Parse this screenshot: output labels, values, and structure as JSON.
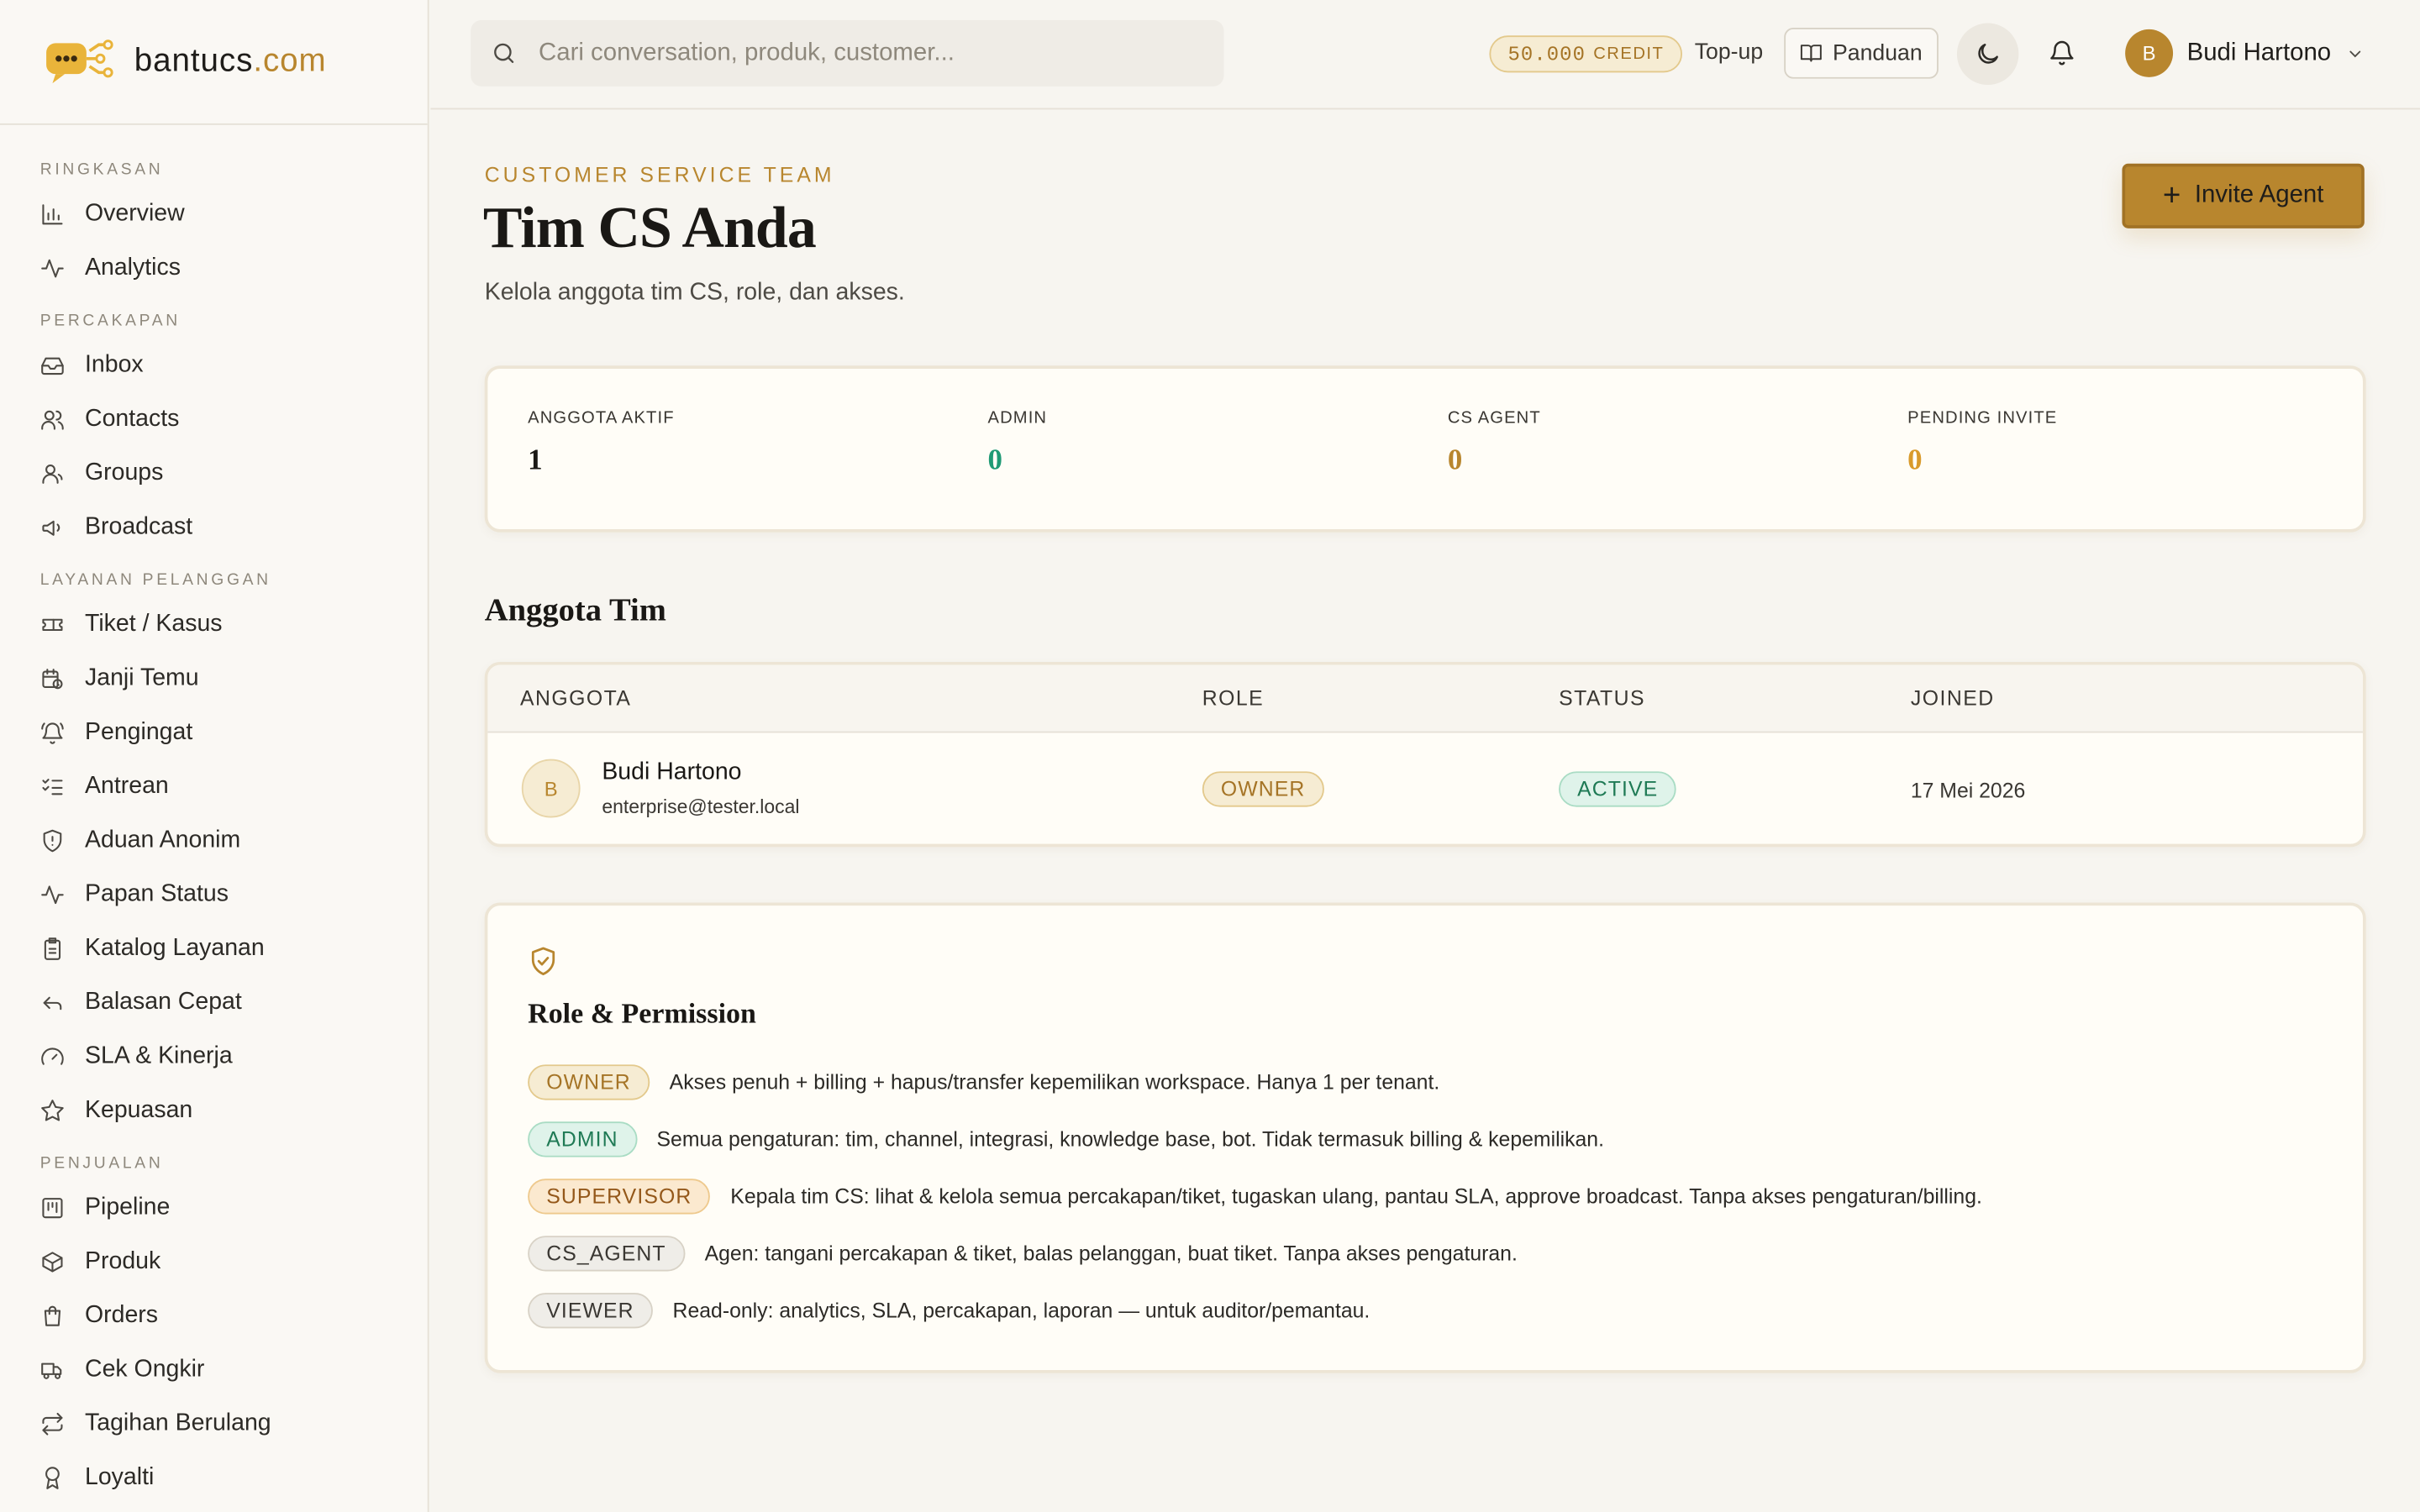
{
  "brand": {
    "name": "bantucs",
    "tld": ".com"
  },
  "search": {
    "placeholder": "Cari conversation, produk, customer..."
  },
  "topbar": {
    "credit_amount": "50.000",
    "credit_label": "CREDIT",
    "topup_label": "Top-up",
    "guide_label": "Panduan",
    "user_initial": "B",
    "user_name": "Budi Hartono"
  },
  "sidebar": {
    "sections": [
      {
        "title": "RINGKASAN",
        "items": [
          {
            "label": "Overview",
            "icon": "bar-chart-icon"
          },
          {
            "label": "Analytics",
            "icon": "activity-icon"
          }
        ]
      },
      {
        "title": "PERCAKAPAN",
        "items": [
          {
            "label": "Inbox",
            "icon": "inbox-icon"
          },
          {
            "label": "Contacts",
            "icon": "users-icon"
          },
          {
            "label": "Groups",
            "icon": "group-icon"
          },
          {
            "label": "Broadcast",
            "icon": "megaphone-icon"
          }
        ]
      },
      {
        "title": "LAYANAN PELANGGAN",
        "items": [
          {
            "label": "Tiket / Kasus",
            "icon": "ticket-icon"
          },
          {
            "label": "Janji Temu",
            "icon": "calendar-clock-icon"
          },
          {
            "label": "Pengingat",
            "icon": "bell-ring-icon"
          },
          {
            "label": "Antrean",
            "icon": "list-checks-icon"
          },
          {
            "label": "Aduan Anonim",
            "icon": "shield-icon"
          },
          {
            "label": "Papan Status",
            "icon": "activity-icon"
          },
          {
            "label": "Katalog Layanan",
            "icon": "clipboard-icon"
          },
          {
            "label": "Balasan Cepat",
            "icon": "reply-icon"
          },
          {
            "label": "SLA & Kinerja",
            "icon": "gauge-icon"
          },
          {
            "label": "Kepuasan",
            "icon": "star-icon"
          }
        ]
      },
      {
        "title": "PENJUALAN",
        "items": [
          {
            "label": "Pipeline",
            "icon": "kanban-icon"
          },
          {
            "label": "Produk",
            "icon": "package-icon"
          },
          {
            "label": "Orders",
            "icon": "shopping-bag-icon"
          },
          {
            "label": "Cek Ongkir",
            "icon": "truck-icon"
          },
          {
            "label": "Tagihan Berulang",
            "icon": "repeat-icon"
          },
          {
            "label": "Loyalti",
            "icon": "award-icon"
          }
        ]
      }
    ]
  },
  "page": {
    "eyebrow": "CUSTOMER SERVICE TEAM",
    "title": "Tim CS Anda",
    "subtitle": "Kelola anggota tim CS, role, dan akses.",
    "invite_label": "Invite Agent"
  },
  "stats": [
    {
      "label": "ANGGOTA AKTIF",
      "value": "1",
      "color": "#1a1815"
    },
    {
      "label": "ADMIN",
      "value": "0",
      "color": "#1f9a75"
    },
    {
      "label": "CS AGENT",
      "value": "0",
      "color": "#b8862e"
    },
    {
      "label": "PENDING INVITE",
      "value": "0",
      "color": "#d99a2b"
    }
  ],
  "team": {
    "title": "Anggota Tim",
    "columns": [
      "ANGGOTA",
      "ROLE",
      "STATUS",
      "JOINED"
    ],
    "rows": [
      {
        "initial": "B",
        "name": "Budi Hartono",
        "email": "enterprise@tester.local",
        "role": "OWNER",
        "status": "ACTIVE",
        "joined": "17 Mei 2026"
      }
    ]
  },
  "permissions": {
    "title": "Role & Permission",
    "roles": [
      {
        "role": "OWNER",
        "desc": "Akses penuh + billing + hapus/transfer kepemilikan workspace. Hanya 1 per tenant."
      },
      {
        "role": "ADMIN",
        "desc": "Semua pengaturan: tim, channel, integrasi, knowledge base, bot. Tidak termasuk billing & kepemilikan."
      },
      {
        "role": "SUPERVISOR",
        "desc": "Kepala tim CS: lihat & kelola semua percakapan/tiket, tugaskan ulang, pantau SLA, approve broadcast. Tanpa akses pengaturan/billing."
      },
      {
        "role": "CS_AGENT",
        "desc": "Agen: tangani percakapan & tiket, balas pelanggan, buat tiket. Tanpa akses pengaturan."
      },
      {
        "role": "VIEWER",
        "desc": "Read-only: analytics, SLA, percakapan, laporan — untuk auditor/pemantau."
      }
    ]
  }
}
